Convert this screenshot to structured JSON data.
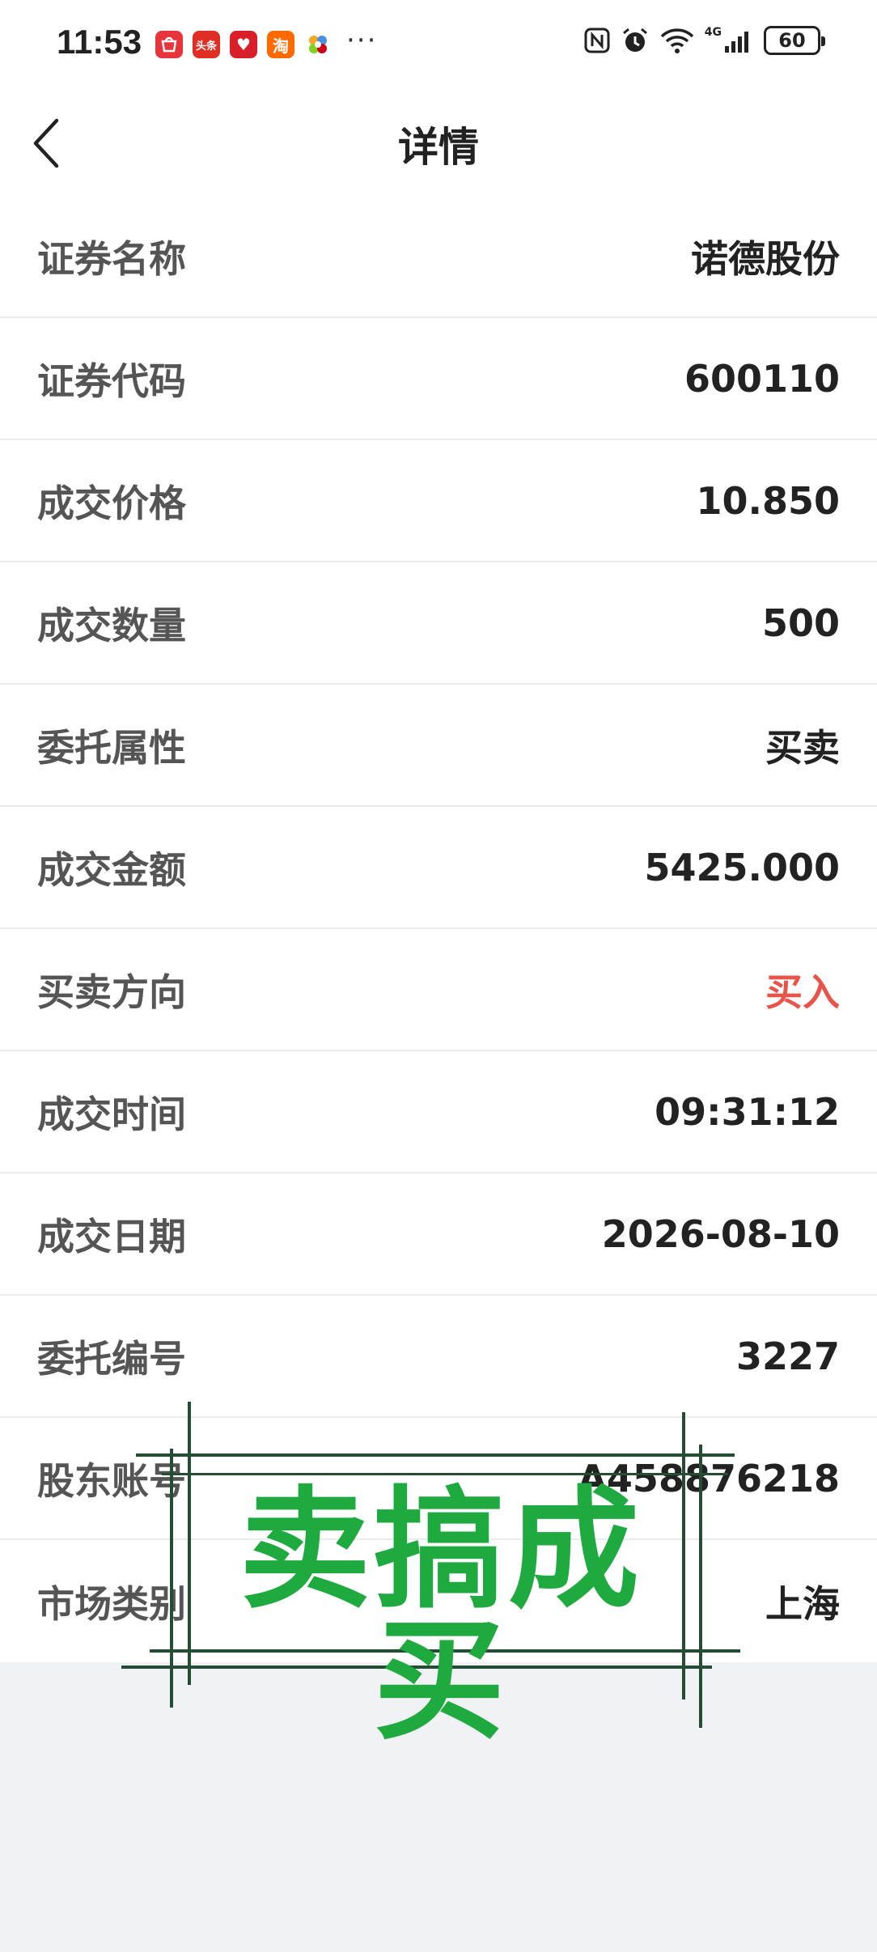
{
  "status_bar": {
    "time": "11:53",
    "app_icons": [
      {
        "name": "huawei-store-icon",
        "glyph": "HW",
        "color": "#e8343b"
      },
      {
        "name": "toutiao-icon",
        "glyph": "头条",
        "color": "#e02e24"
      },
      {
        "name": "heart-app-icon",
        "glyph": "♥",
        "color": "#d91f2a"
      },
      {
        "name": "taobao-icon",
        "glyph": "淘",
        "color": "#ff6a00"
      },
      {
        "name": "pinwheel-app-icon",
        "glyph": "✿",
        "color": "#ffffff"
      }
    ],
    "more": "···",
    "network": "4G",
    "battery": "60"
  },
  "header": {
    "title": "详情"
  },
  "details": [
    {
      "label": "证券名称",
      "value": "诺德股份"
    },
    {
      "label": "证券代码",
      "value": "600110"
    },
    {
      "label": "成交价格",
      "value": "10.850"
    },
    {
      "label": "成交数量",
      "value": "500"
    },
    {
      "label": "委托属性",
      "value": "买卖"
    },
    {
      "label": "成交金额",
      "value": "5425.000"
    },
    {
      "label": "买卖方向",
      "value": "买入"
    },
    {
      "label": "成交时间",
      "value": "09:31:12"
    },
    {
      "label": "成交日期",
      "value": "2026-08-10"
    },
    {
      "label": "委托编号",
      "value": "3227"
    },
    {
      "label": "股东账号",
      "value": "A458876218"
    },
    {
      "label": "市场类别",
      "value": "上海"
    }
  ],
  "stamp": {
    "text": "卖搞成买"
  },
  "colors": {
    "buy_red": "#e8544a",
    "stamp_green": "#1faa3f",
    "stamp_frame": "#254d33"
  }
}
